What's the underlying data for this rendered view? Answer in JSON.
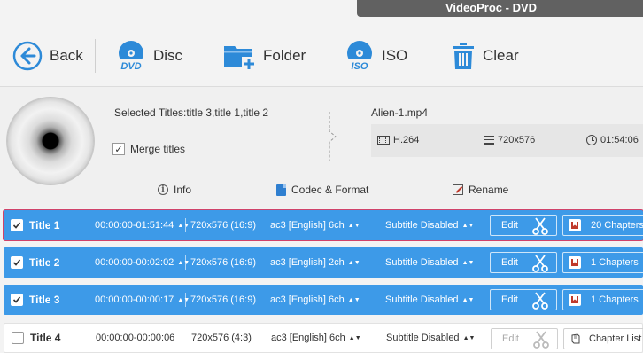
{
  "app": {
    "title": "VideoProc - DVD"
  },
  "toolbar": {
    "back": "Back",
    "disc": "Disc",
    "folder": "Folder",
    "iso": "ISO",
    "clear": "Clear"
  },
  "source": {
    "selected_titles": "Selected Titles:title 3,title 1,title 2",
    "merge_label": "Merge titles",
    "merge_checked": true
  },
  "output": {
    "filename": "Alien-1.mp4",
    "codec": "H.264",
    "resolution": "720x576",
    "duration": "01:54:06"
  },
  "tabs": {
    "info": "Info",
    "codec": "Codec & Format",
    "rename": "Rename"
  },
  "rows": [
    {
      "title": "Title 1",
      "time": "00:00:00-01:51:44",
      "res": "720x576 (16:9)",
      "audio": "ac3 [English] 6ch",
      "subtitle": "Subtitle Disabled",
      "edit": "Edit",
      "chapters": "20 Chapters",
      "checked": true
    },
    {
      "title": "Title 2",
      "time": "00:00:00-00:02:02",
      "res": "720x576 (16:9)",
      "audio": "ac3 [English] 2ch",
      "subtitle": "Subtitle Disabled",
      "edit": "Edit",
      "chapters": "1 Chapters",
      "checked": true
    },
    {
      "title": "Title 3",
      "time": "00:00:00-00:00:17",
      "res": "720x576 (16:9)",
      "audio": "ac3 [English] 6ch",
      "subtitle": "Subtitle Disabled",
      "edit": "Edit",
      "chapters": "1 Chapters",
      "checked": true
    },
    {
      "title": "Title 4",
      "time": "00:00:00-00:00:06",
      "res": "720x576 (4:3)",
      "audio": "ac3 [English] 6ch",
      "subtitle": "Subtitle Disabled",
      "edit": "Edit",
      "chapters": "Chapter List",
      "checked": false
    }
  ],
  "icons": {
    "back": "back-arrow-icon",
    "disc": "dvd-disc-icon",
    "folder": "folder-add-icon",
    "iso": "iso-disc-icon",
    "clear": "trash-icon",
    "scissors": "scissors-icon",
    "chapters": "book-icon"
  },
  "colors": {
    "accent": "#2d8ad8",
    "row_blue": "#3d9ae8",
    "selected_outline": "#d0436a"
  }
}
